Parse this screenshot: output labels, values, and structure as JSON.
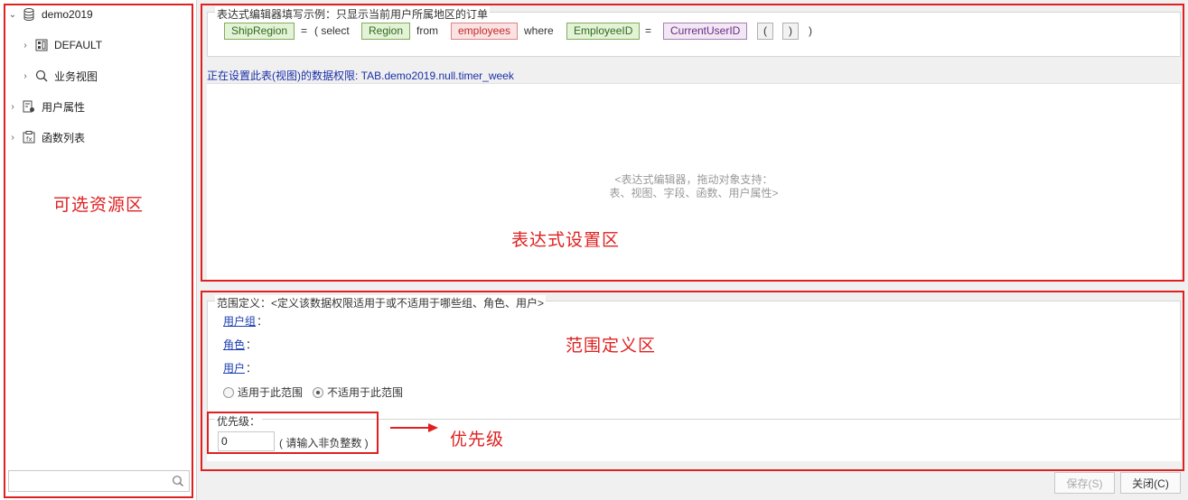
{
  "tree": {
    "root": "demo2019",
    "children": [
      "DEFAULT",
      "业务视图"
    ],
    "user_attributes": "用户属性",
    "function_list": "函数列表"
  },
  "search": {
    "placeholder": ""
  },
  "expression": {
    "legend": "表达式编辑器填写示例：只显示当前用户所属地区的订单",
    "tokens": {
      "ship_region": "ShipRegion",
      "eq1": "=",
      "open_select": "( select",
      "region": "Region",
      "from": "from",
      "employees": "employees",
      "where": "where",
      "employee_id": "EmployeeID",
      "eq2": "=",
      "current_user_id": "CurrentUserID",
      "paren_open": "(",
      "paren_close": ")",
      "close_paren": ")"
    },
    "status": "正在设置此表(视图)的数据权限: TAB.demo2019.null.timer_week",
    "hint_line1": "<表达式编辑器，拖动对象支持：",
    "hint_line2": "表、视图、字段、函数、用户属性>"
  },
  "scope": {
    "legend": "范围定义：<定义该数据权限适用于或不适用于哪些组、角色、用户>",
    "user_group": "用户组",
    "role": "角色",
    "user": "用户",
    "colon": "：",
    "apply_label": "适用于此范围",
    "not_apply_label": "不适用于此范围",
    "selected": "not_apply"
  },
  "priority": {
    "legend": "优先级：",
    "value": "0",
    "hint": "( 请输入非负整数 )"
  },
  "buttons": {
    "save": "保存(S)",
    "close": "关闭(C)"
  },
  "annotations": {
    "resource_area": "可选资源区",
    "expression_area": "表达式设置区",
    "scope_area": "范围定义区",
    "priority": "优先级",
    "color": "#e02020"
  }
}
